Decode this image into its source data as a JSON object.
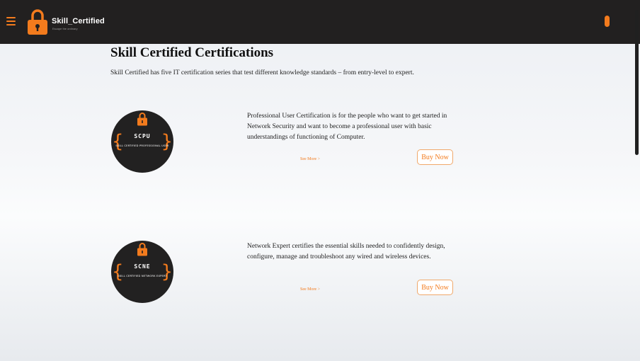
{
  "nav": {
    "brand": "Skill_Certified",
    "tagline": "Escape the ordinary",
    "menu_icon": "hamburger-menu-icon",
    "logo_icon": "padlock-icon"
  },
  "colors": {
    "accent": "#f37b1d",
    "navbar_bg": "#222020",
    "badge_bg": "#222121"
  },
  "main": {
    "title": "Skill Certified Certifications",
    "intro": "Skill Certified has five IT certification series that test different knowledge standards – from entry-level to expert."
  },
  "certifications": [
    {
      "badge_code": "SCPU",
      "badge_subtitle": "SKILL CERTIFIED PROFESSIONAL USER",
      "description": "Professional User Certification is for the people who want to get started in Network Security and want to become a professional user with basic understandings of functioning of Computer.",
      "see_more": "See More >",
      "buy_label": "Buy Now"
    },
    {
      "badge_code": "SCNE",
      "badge_subtitle": "SKILL CERTIFIED NETWORK EXPERT",
      "description": "Network Expert certifies the essential skills needed to confidently design, configure, manage and troubleshoot any wired and wireless devices.",
      "see_more": "See More >",
      "buy_label": "Buy Now"
    }
  ],
  "badge_braces": {
    "left": "{",
    "right": "}"
  }
}
